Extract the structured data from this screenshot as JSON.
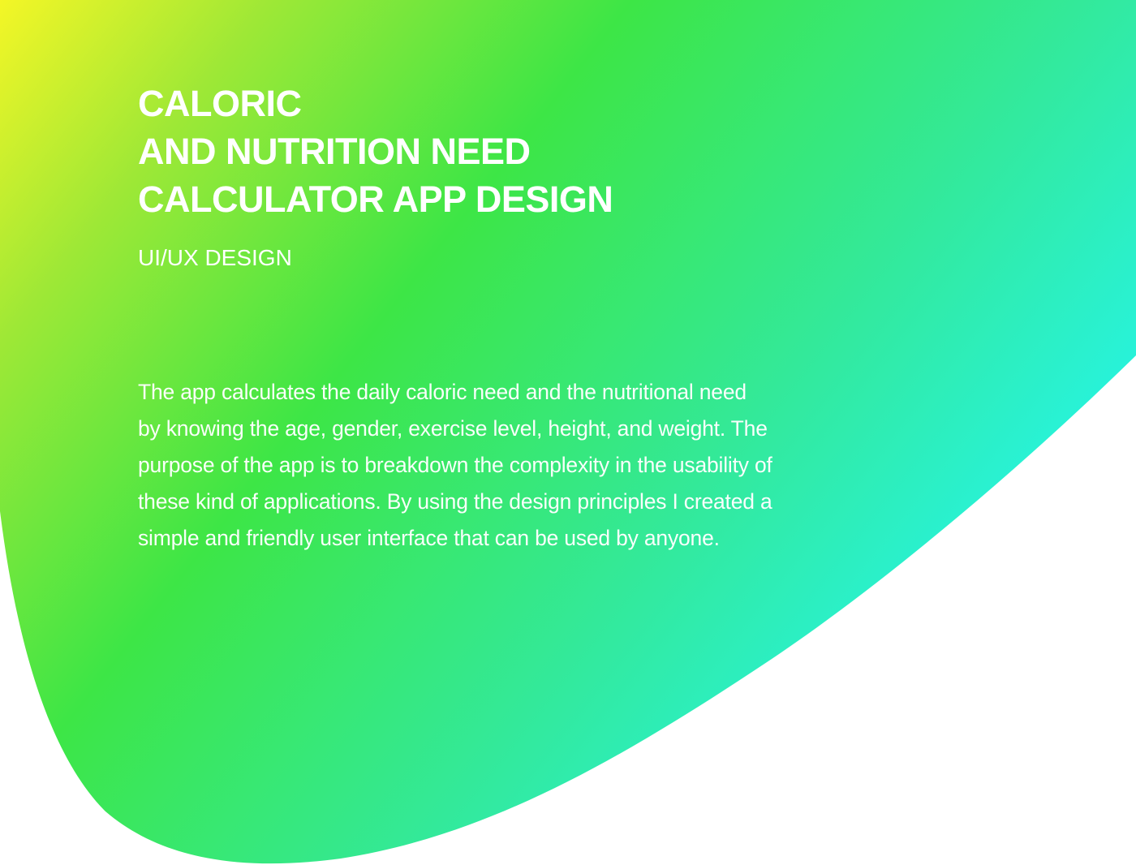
{
  "hero": {
    "title_lines": [
      "CALORIC",
      "AND NUTRITION NEED",
      "CALCULATOR APP DESIGN"
    ],
    "subtitle": "UI/UX DESIGN",
    "description_lines": [
      "The app calculates the daily caloric need and the nutritional need",
      "by knowing the age, gender, exercise level, height, and weight. The",
      "purpose of the app is to breakdown the complexity in the usability of",
      "these kind of applications. By using the design principles I created a",
      "simple and friendly user interface that can be used by anyone."
    ]
  },
  "colors": {
    "background": "#ffffff",
    "gradient_yellow": "#f4f626",
    "gradient_lime": "#9ee836",
    "gradient_green": "#3de646",
    "gradient_mint": "#33e99a",
    "gradient_cyan": "#25f5ea",
    "text": "#ffffff"
  }
}
